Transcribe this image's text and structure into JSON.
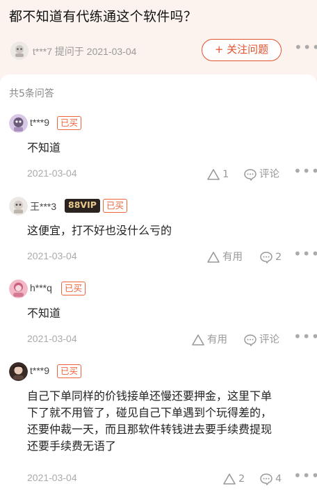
{
  "question": {
    "title": "都不知道有代练通这个软件吗？",
    "asker": "t***7 提问于 2021-03-04",
    "follow_label": "+ 关注问题",
    "more": "•••"
  },
  "answers_header": "共5条问答",
  "answers": [
    {
      "name": "t***9",
      "badges": [
        "已买"
      ],
      "text": "不知道",
      "date": "2021-03-04",
      "like_label": "1",
      "comment_label": "评论",
      "more": "•••"
    },
    {
      "name": "王***3",
      "vip": "88VIP",
      "badges": [
        "已买"
      ],
      "text": "这便宜，打不好也没什么亏的",
      "date": "2021-03-04",
      "like_label": "有用",
      "comment_label": "2",
      "more": "•••"
    },
    {
      "name": "h***q",
      "badges": [
        "已买"
      ],
      "text": "不知道",
      "date": "2021-03-04",
      "like_label": "有用",
      "comment_label": "评论",
      "more": "•••"
    },
    {
      "name": "t***9",
      "badges": [
        "已买"
      ],
      "text_lines": [
        "自己下单同样的价钱接单还慢还要押金，这里下单",
        "下了就不用管了，碰见自己下单遇到个玩得差的，",
        "还要仲裁一天，而且那软件转钱进去要手续费提现",
        "还要手续费无语了"
      ],
      "date": "2021-03-04",
      "like_label": "2",
      "comment_label": "4",
      "more": "•••"
    }
  ],
  "colors": {
    "accent": "#e0512e",
    "page_bg": "#fdf3ee",
    "vip_bg": "#2b2320",
    "vip_text": "#e9c98c"
  },
  "icons": {
    "like": "triangle-like-icon",
    "comment": "speech-bubble-icon",
    "more": "more-dots-icon"
  }
}
